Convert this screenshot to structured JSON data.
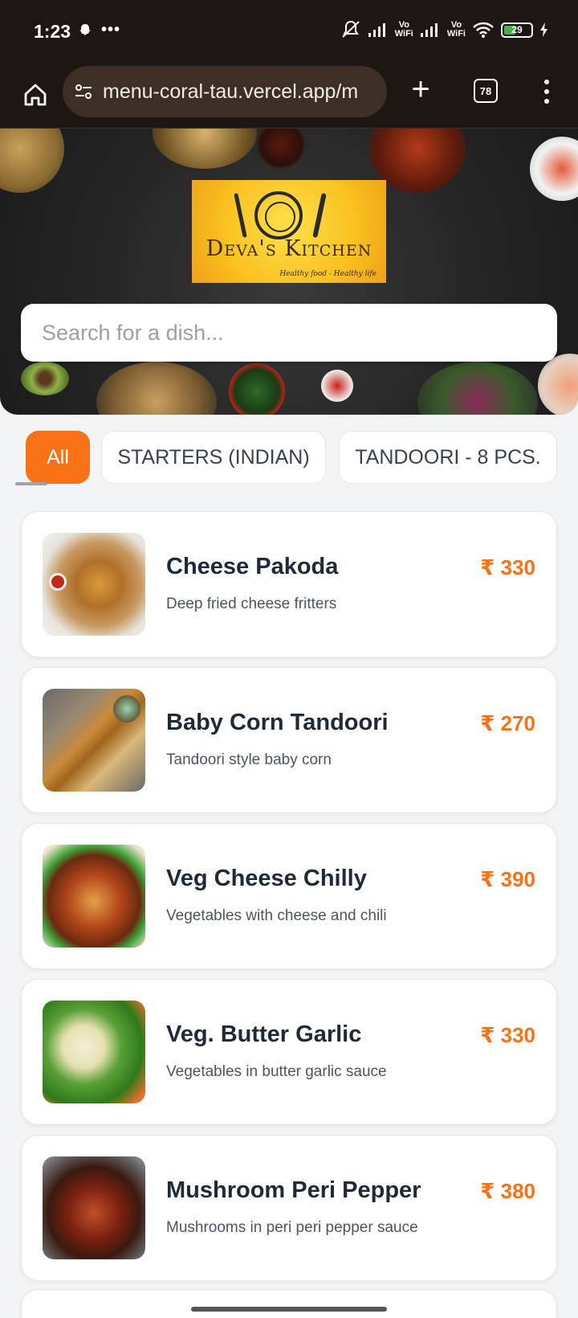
{
  "status_bar": {
    "time": "1:23",
    "battery": "29",
    "network_label_1": "Vo\nWiFi",
    "network_label_2": "Vo\nWiFi"
  },
  "browser": {
    "url": "menu-coral-tau.vercel.app/m",
    "tab_count": "78"
  },
  "header": {
    "logo_title": "Deva's Kitchen",
    "logo_tagline": "Healthy food - Healthy life",
    "search_placeholder": "Search for a dish..."
  },
  "categories": [
    {
      "label": "All",
      "active": true
    },
    {
      "label": "STARTERS (INDIAN)",
      "active": false
    },
    {
      "label": "TANDOORI - 8 PCS.",
      "active": false
    }
  ],
  "menu_items": [
    {
      "name": "Cheese Pakoda",
      "description": "Deep fried cheese fritters",
      "price": "₹ 330"
    },
    {
      "name": "Baby Corn Tandoori",
      "description": "Tandoori style baby corn",
      "price": "₹ 270"
    },
    {
      "name": "Veg Cheese Chilly",
      "description": "Vegetables with cheese and chili",
      "price": "₹ 390"
    },
    {
      "name": "Veg. Butter Garlic",
      "description": "Vegetables in butter garlic sauce",
      "price": "₹ 330"
    },
    {
      "name": "Mushroom Peri Pepper",
      "description": "Mushrooms in peri peri pepper sauce",
      "price": "₹ 380"
    }
  ],
  "colors": {
    "accent": "#f97316",
    "page_background": "#f3f4f6",
    "browser_chrome": "#1e1612"
  }
}
